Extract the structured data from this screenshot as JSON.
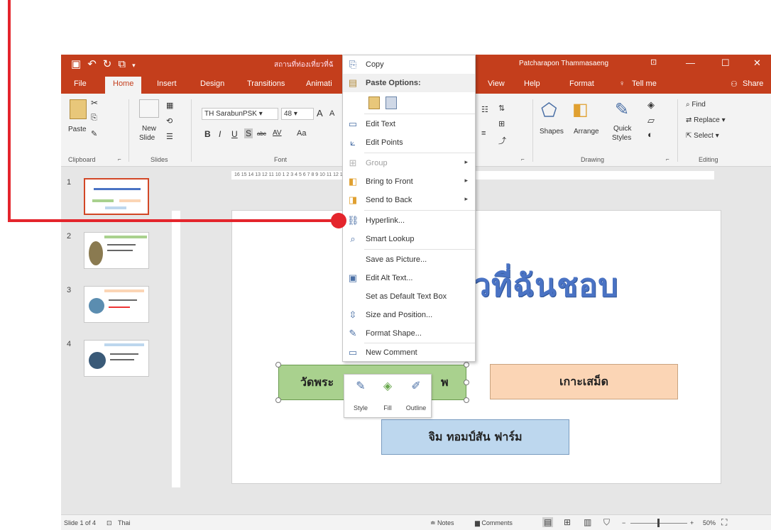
{
  "titlebar": {
    "qat_icons": [
      "save-icon",
      "undo-icon",
      "redo-icon",
      "start-icon",
      "customize-icon"
    ],
    "document_title": "สถานที่ท่องเที่ยวที่ฉั",
    "user": "Patcharapon Thammasaeng",
    "window_buttons": [
      "ribbon-display-icon",
      "minimize-icon",
      "maximize-icon",
      "close-icon"
    ]
  },
  "tabs": {
    "file": "File",
    "home": "Home",
    "insert": "Insert",
    "design": "Design",
    "transitions": "Transitions",
    "animations": "Animati",
    "view": "View",
    "help": "Help",
    "format": "Format",
    "tell_me": "Tell me",
    "share": "Share"
  },
  "ribbon": {
    "paste": "Paste",
    "clipboard": "Clipboard",
    "new_slide_1": "New",
    "new_slide_2": "Slide",
    "slides": "Slides",
    "font_name": "TH SarabunPSK",
    "font_size": "48",
    "font": "Font",
    "bold": "B",
    "italic": "I",
    "underline": "U",
    "shadow": "S",
    "strike": "abc",
    "spacing": "AV",
    "case": "Aa",
    "grow": "A",
    "shrink": "A",
    "shapes": "Shapes",
    "arrange": "Arrange",
    "quick_styles_1": "Quick",
    "quick_styles_2": "Styles",
    "drawing": "Drawing",
    "find": "Find",
    "replace": "Replace",
    "select": "Select",
    "editing": "Editing"
  },
  "context_menu": {
    "copy": "Copy",
    "paste_options": "Paste Options:",
    "edit_text": "Edit Text",
    "edit_points": "Edit Points",
    "group": "Group",
    "bring_to_front": "Bring to Front",
    "send_to_back": "Send to Back",
    "hyperlink": "Hyperlink...",
    "smart_lookup": "Smart Lookup",
    "save_as_picture": "Save as Picture...",
    "edit_alt_text": "Edit Alt Text...",
    "set_default_text_box": "Set as Default Text Box",
    "size_and_position": "Size and Position...",
    "format_shape": "Format Shape...",
    "new_comment": "New Comment"
  },
  "mini_toolbar": {
    "style": "Style",
    "fill": "Fill",
    "outline": "Outline"
  },
  "hruler_text": "16 15 14 13 12 11 10          1 2 3 4 5 6 7 8 9 10 11 12 13 14 15 16",
  "slides": [
    {
      "number": "1"
    },
    {
      "number": "2"
    },
    {
      "number": "3"
    },
    {
      "number": "4"
    }
  ],
  "slide": {
    "title": "สถา่วที่ยวที่ฉันชอบ",
    "green_button": "วัดพระ",
    "green_button_tail": "พ",
    "peach_button": "เกาะเสม็ด",
    "blue_button": "จิม ทอมป์สัน ฟาร์ม"
  },
  "statusbar": {
    "slide_info": "Slide 1 of 4",
    "language": "Thai",
    "notes": "Notes",
    "comments": "Comments",
    "zoom": "50%",
    "zoom_minus": "−",
    "zoom_plus": "+"
  },
  "colors": {
    "accent": "#c43e1c",
    "annotation": "#e4252c"
  }
}
